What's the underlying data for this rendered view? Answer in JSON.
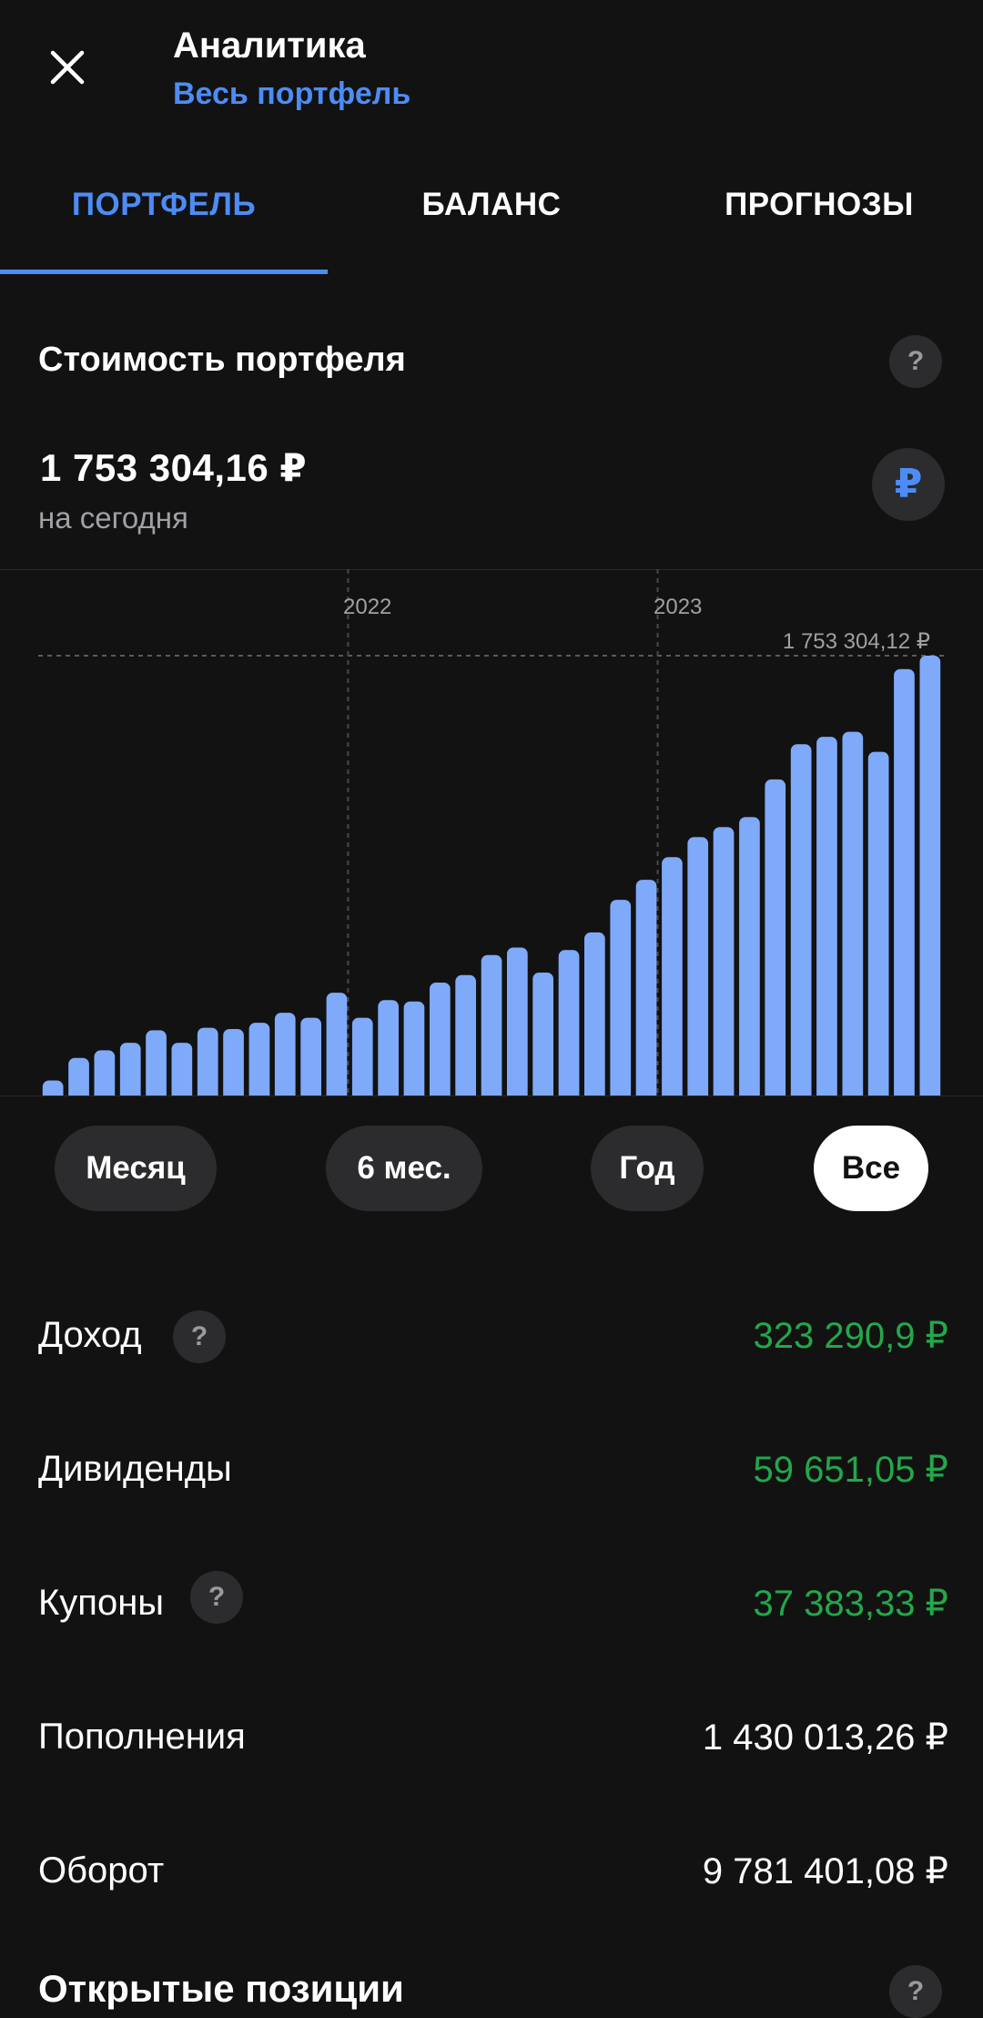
{
  "header": {
    "title": "Аналитика",
    "subtitle": "Весь портфель"
  },
  "tabs": [
    {
      "label": "ПОРТФЕЛЬ",
      "active": true
    },
    {
      "label": "БАЛАНС",
      "active": false
    },
    {
      "label": "ПРОГНОЗЫ",
      "active": false
    }
  ],
  "portfolio": {
    "section_title": "Стоимость портфеля",
    "help": "?",
    "value": "1 753 304,16  ₽",
    "caption": "на сегодня",
    "currency_symbol": "₽"
  },
  "chart_data": {
    "type": "bar",
    "year_labels": [
      "2022",
      "2023"
    ],
    "max_label": "1 753 304,12 ₽",
    "values": [
      60000,
      150000,
      180000,
      210000,
      260000,
      210000,
      270000,
      265000,
      290000,
      330000,
      310000,
      410000,
      310000,
      380000,
      375000,
      450000,
      480000,
      560000,
      590000,
      490000,
      580000,
      650000,
      780000,
      860000,
      950000,
      1030000,
      1070000,
      1110000,
      1260000,
      1400000,
      1430000,
      1450000,
      1370000,
      1700000,
      1753304
    ],
    "year_boundaries": [
      11,
      23
    ],
    "ylim": [
      0,
      1753304
    ],
    "bar_color": "#7faafa"
  },
  "periods": [
    {
      "label": "Месяц",
      "selected": false
    },
    {
      "label": "6 мес.",
      "selected": false
    },
    {
      "label": "Год",
      "selected": false
    },
    {
      "label": "Все",
      "selected": true
    }
  ],
  "stats": [
    {
      "label": "Доход",
      "value": "323 290,9 ₽",
      "color": "#22a84a",
      "help": "?"
    },
    {
      "label": "Дивиденды",
      "value": "59 651,05 ₽",
      "color": "#22a84a"
    },
    {
      "label": "Купоны",
      "value": "37 383,33 ₽",
      "color": "#22a84a"
    },
    {
      "label": "Пополнения",
      "value": "1 430 013,26 ₽",
      "color": "#ffffff"
    },
    {
      "label": "Оборот",
      "value": "9 781 401,08 ₽",
      "color": "#ffffff",
      "help": "?"
    }
  ],
  "open_positions": {
    "title": "Открытые позиции",
    "help": "?"
  },
  "colors": {
    "accent": "#4d8cf5",
    "positive": "#22a84a",
    "background": "#121212"
  }
}
